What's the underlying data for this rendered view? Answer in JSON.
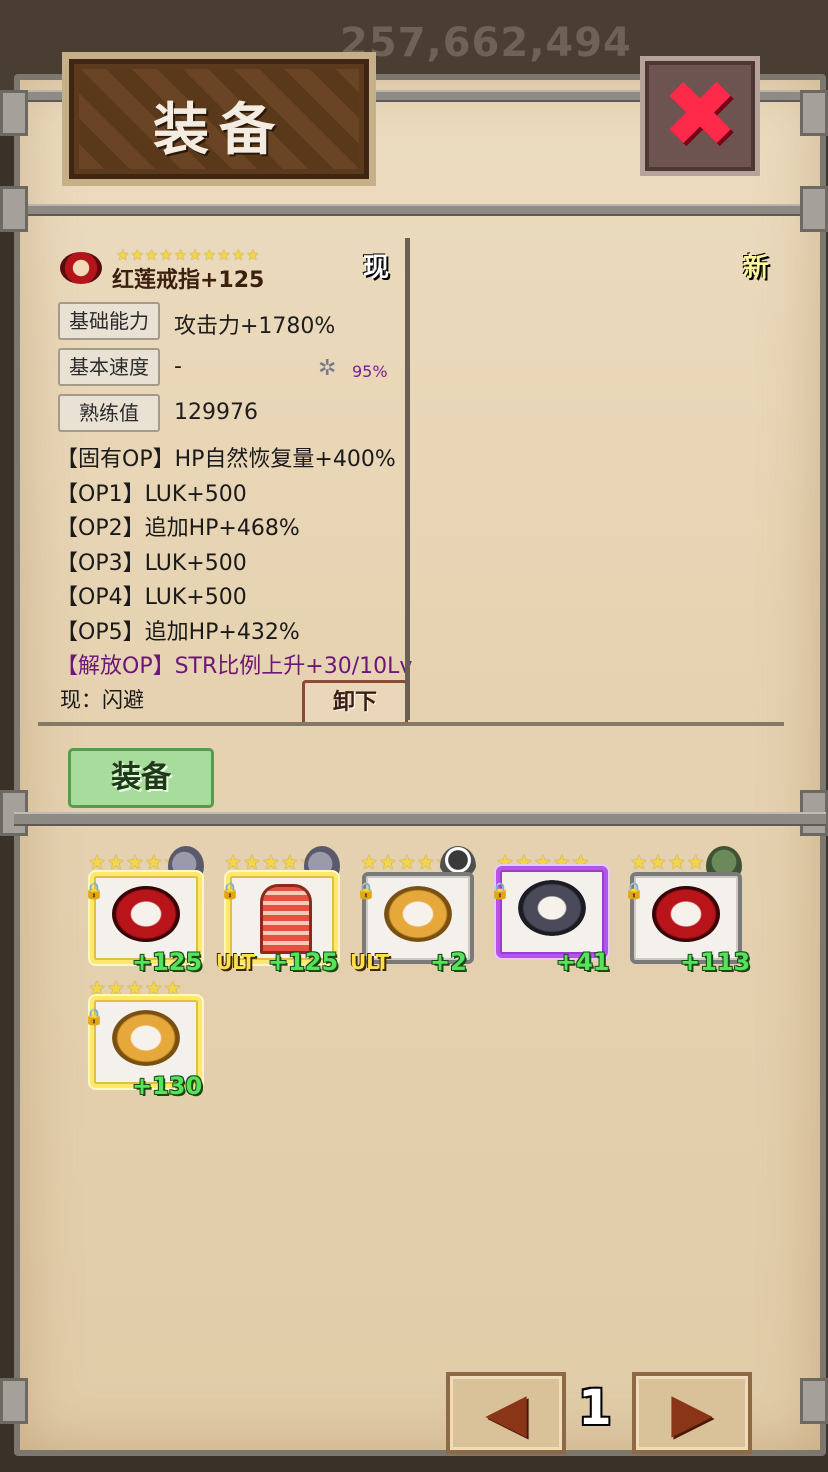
{
  "background": {
    "gold_amount": "257,662,494"
  },
  "header": {
    "title": "装备"
  },
  "current_item": {
    "name": "红莲戒指+125",
    "stars": "★★★★★★★★★★",
    "badge_current": "现",
    "badge_new": "新",
    "stats": {
      "base_ability_label": "基础能力",
      "base_ability_value": "攻击力+1780%",
      "base_speed_label": "基本速度",
      "base_speed_value": "-",
      "speed_percent": "95%",
      "proficiency_label": "熟练值",
      "proficiency_value": "129976"
    },
    "options": [
      {
        "text": "【固有OP】HP自然恢复量+400%"
      },
      {
        "text": "【OP1】LUK+500"
      },
      {
        "text": "【OP2】追加HP+468%"
      },
      {
        "text": "【OP3】LUK+500"
      },
      {
        "text": "【OP4】LUK+500"
      },
      {
        "text": "【OP5】追加HP+432%"
      },
      {
        "text": "【解放OP】STR比例上升+30/10Lv"
      }
    ],
    "current_skill": "现：闪避",
    "unequip_label": "卸下"
  },
  "equip_button_label": "装备",
  "inventory": [
    {
      "stars": "★★★★★",
      "icon": "red-ring",
      "plus": "+125",
      "ult": "",
      "rarity": "gold",
      "avatar": "stone-beast"
    },
    {
      "stars": "★★★★★",
      "icon": "gate-charm",
      "plus": "+125",
      "ult": "ULT",
      "rarity": "gold",
      "avatar": "stone-beast"
    },
    {
      "stars": "★★★★★",
      "icon": "gold-ring",
      "plus": "+2",
      "ult": "ULT",
      "rarity": "grey",
      "avatar": "dark-swordsman"
    },
    {
      "stars": "★★★★★",
      "icon": "dark-ring",
      "plus": "+41",
      "ult": "",
      "rarity": "purple",
      "avatar": ""
    },
    {
      "stars": "★★★★★",
      "icon": "red-ring",
      "plus": "+113",
      "ult": "",
      "rarity": "grey",
      "avatar": "green-soldier"
    },
    {
      "stars": "★★★★★",
      "icon": "gold-ring",
      "plus": "+130",
      "ult": "",
      "rarity": "gold",
      "avatar": ""
    }
  ],
  "pagination": {
    "page": "1",
    "prev_icon": "◀",
    "next_icon": "▶"
  },
  "icons": {
    "close": "✖",
    "lock": "🔒",
    "gear": "✲"
  }
}
